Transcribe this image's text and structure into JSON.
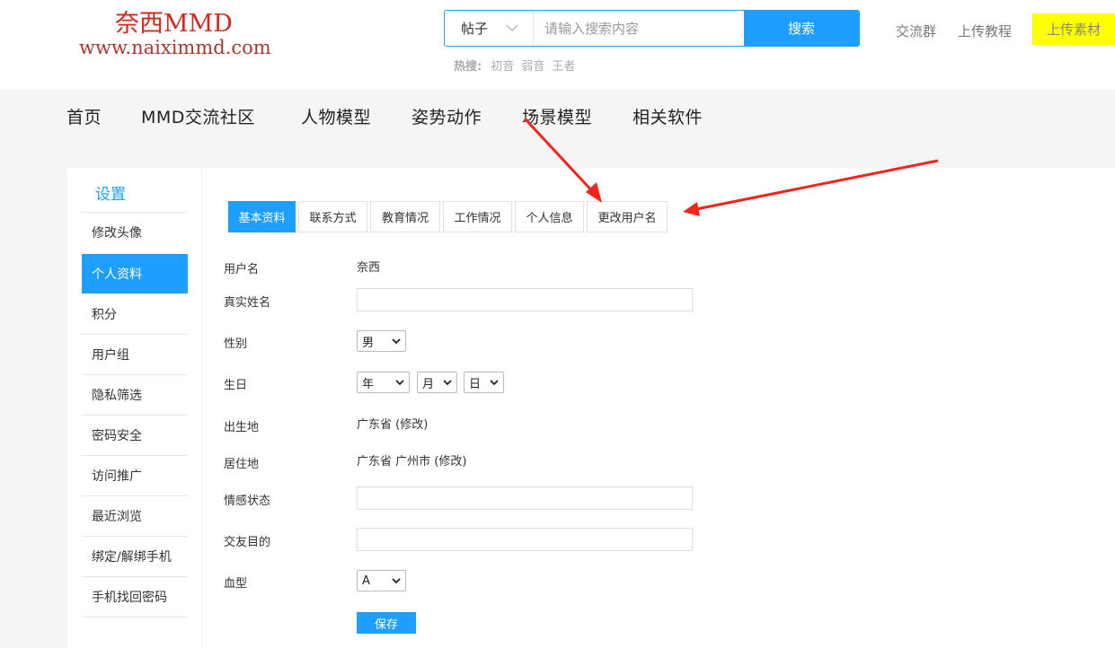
{
  "brand": {
    "title": "奈西MMD",
    "url": "www.naiximmd.com"
  },
  "search": {
    "type": "帖子",
    "placeholder": "请输入搜索内容",
    "button": "搜索",
    "hot_label": "热搜:",
    "hot_items": [
      "初音",
      "弱音",
      "王者"
    ]
  },
  "top_links": {
    "group": "交流群",
    "tutorial": "上传教程",
    "upload": "上传素材"
  },
  "nav": [
    "首页",
    "MMD交流社区",
    "人物模型",
    "姿势动作",
    "场景模型",
    "相关软件"
  ],
  "sidebar": {
    "title": "设置",
    "items": [
      "修改头像",
      "个人资料",
      "积分",
      "用户组",
      "隐私筛选",
      "密码安全",
      "访问推广",
      "最近浏览",
      "绑定/解绑手机",
      "手机找回密码"
    ],
    "active_index": 1
  },
  "tabs": [
    "基本资料",
    "联系方式",
    "教育情况",
    "工作情况",
    "个人信息",
    "更改用户名"
  ],
  "form": {
    "username_label": "用户名",
    "username_value": "奈西",
    "realname_label": "真实姓名",
    "gender_label": "性别",
    "gender_value": "男",
    "birthday_label": "生日",
    "birth_year": "年",
    "birth_month": "月",
    "birth_day": "日",
    "birthplace_label": "出生地",
    "birthplace_value": "广东省 (修改)",
    "residence_label": "居住地",
    "residence_value": "广东省 广州市 (修改)",
    "emotion_label": "情感状态",
    "purpose_label": "交友目的",
    "blood_label": "血型",
    "blood_value": "A",
    "save": "保存"
  },
  "colors": {
    "accent": "#1e9fff",
    "upload_bg": "#ffff00",
    "arrow": "#f2251c",
    "brand": "#d4261c"
  }
}
